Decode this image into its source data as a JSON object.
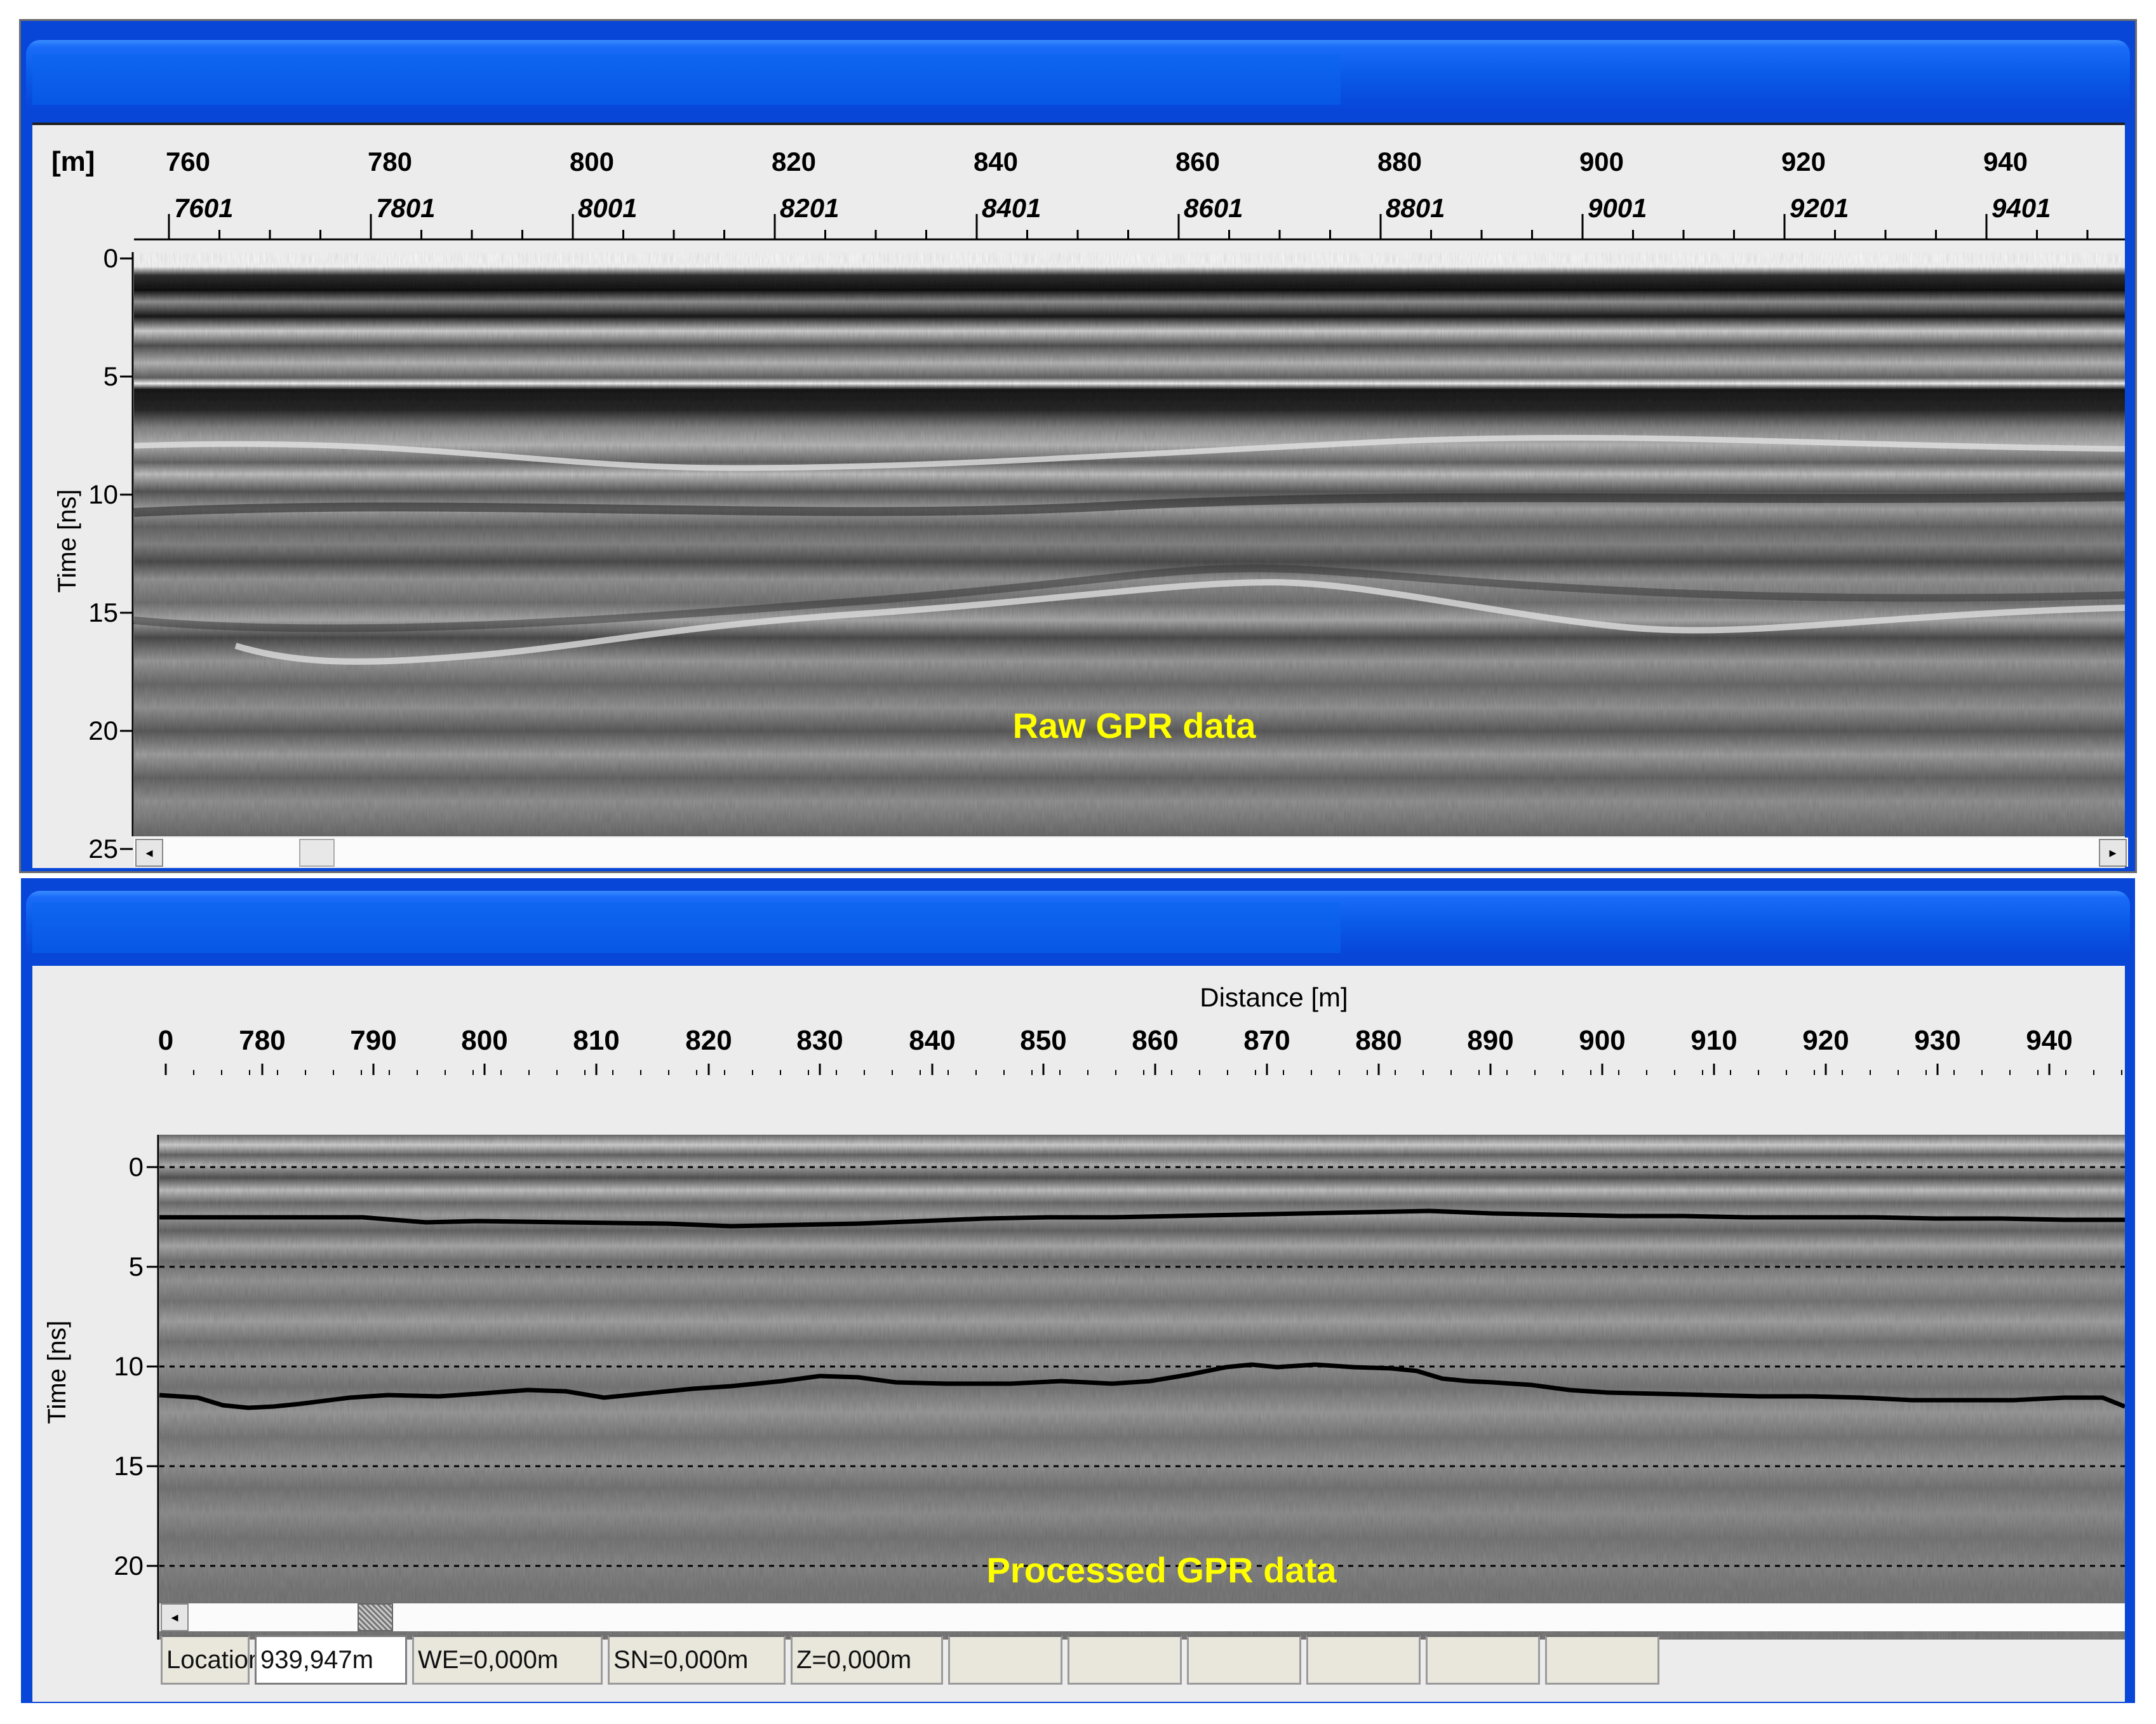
{
  "raw_window": {
    "unit_label": "[m]",
    "top_ticks": [
      "760",
      "780",
      "800",
      "820",
      "840",
      "860",
      "880",
      "900",
      "920",
      "940"
    ],
    "trace_ticks": [
      "7601",
      "7801",
      "8001",
      "8201",
      "8401",
      "8601",
      "8801",
      "9001",
      "9201",
      "9401"
    ],
    "y_axis_label": "Time [ns]",
    "y_ticks": [
      "0",
      "5",
      "10",
      "15",
      "20",
      "25"
    ],
    "overlay_label": "Raw  GPR data",
    "scroll_left": "◂",
    "scroll_right": "▸"
  },
  "processed_window": {
    "x_axis_label": "Distance [m]",
    "x_ticks": [
      "0",
      "780",
      "790",
      "800",
      "810",
      "820",
      "830",
      "840",
      "850",
      "860",
      "870",
      "880",
      "890",
      "900",
      "910",
      "920",
      "930",
      "940"
    ],
    "y_axis_label": "Time [ns]",
    "y_ticks": [
      "0",
      "5",
      "10",
      "15",
      "20"
    ],
    "overlay_label": "Processed GPR data",
    "scroll_left": "◂",
    "statusbar": {
      "location_label": "Location",
      "location_value": "939,947m",
      "we": "WE=0,000m",
      "sn": "SN=0,000m",
      "z": "Z=0,000m"
    }
  },
  "colors": {
    "title_blue": "#0846d8",
    "label_yellow": "#ffff00",
    "radargram_gray": "#7f7f7f"
  }
}
